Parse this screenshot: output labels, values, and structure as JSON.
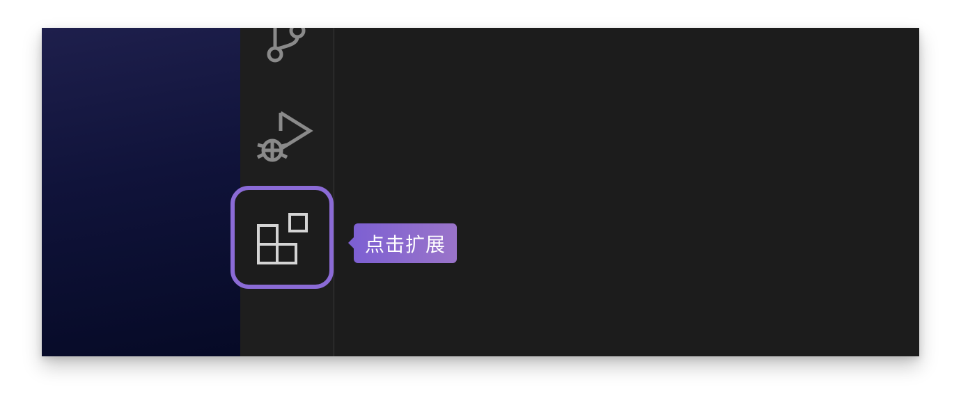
{
  "activity_bar": {
    "items": [
      {
        "icon": "source-control-icon",
        "active": false
      },
      {
        "icon": "run-debug-icon",
        "active": false
      },
      {
        "icon": "extensions-icon",
        "active": true
      }
    ]
  },
  "tooltip": {
    "text": "点击扩展"
  },
  "colors": {
    "highlight": "#8b6bd6",
    "tooltip_start": "#7d60d2",
    "tooltip_end": "#9a74c9",
    "icon_inactive": "#8a8a8a",
    "icon_active": "#d4d4d4",
    "editor_bg": "#1c1c1c"
  }
}
